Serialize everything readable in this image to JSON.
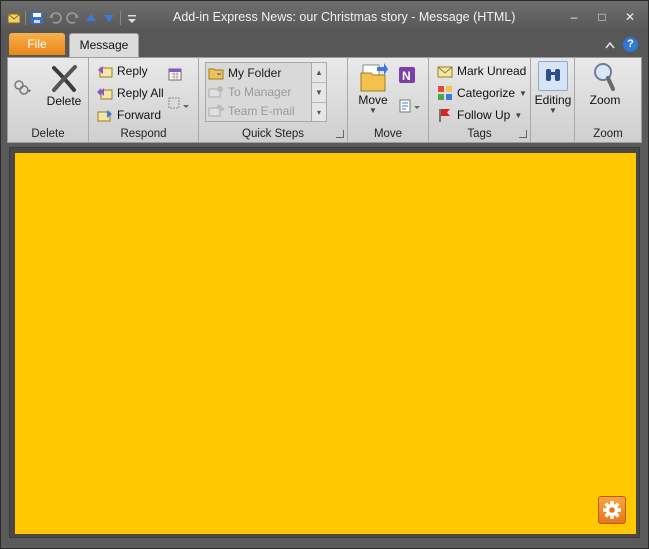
{
  "window": {
    "title": "Add-in Express News: our Christmas story  -  Message (HTML)",
    "minimize": "‒",
    "maximize": "□",
    "close": "✕"
  },
  "tabs": {
    "file": "File",
    "message": "Message"
  },
  "help": "?",
  "ribbon": {
    "delete_group": {
      "label": "Delete",
      "delete_button": "Delete"
    },
    "respond_group": {
      "label": "Respond",
      "reply": "Reply",
      "reply_all": "Reply All",
      "forward": "Forward"
    },
    "quick_steps_group": {
      "label": "Quick Steps",
      "items": [
        "My Folder",
        "To Manager",
        "Team E-mail"
      ]
    },
    "move_group": {
      "label": "Move",
      "move_button": "Move"
    },
    "tags_group": {
      "label": "Tags",
      "mark_unread": "Mark Unread",
      "categorize": "Categorize",
      "follow_up": "Follow Up"
    },
    "editing_group": {
      "label": "Editing"
    },
    "zoom_group": {
      "label": "Zoom",
      "zoom_button": "Zoom"
    }
  },
  "colors": {
    "message_background": "#ffc800",
    "file_tab": "#e8861a"
  },
  "icons": [
    "envelope-icon",
    "save-icon",
    "undo-icon",
    "redo-icon",
    "up-icon",
    "down-icon",
    "customize-icon",
    "delete-x-icon",
    "ignore-icon",
    "reply-icon",
    "reply-all-icon",
    "forward-icon",
    "meeting-icon",
    "more-respond-icon",
    "folder-icon",
    "manager-icon",
    "team-email-icon",
    "move-icon",
    "onenote-icon",
    "rules-icon",
    "mark-unread-icon",
    "categorize-icon",
    "flag-icon",
    "binoculars-icon",
    "magnifier-icon",
    "gear-icon"
  ]
}
